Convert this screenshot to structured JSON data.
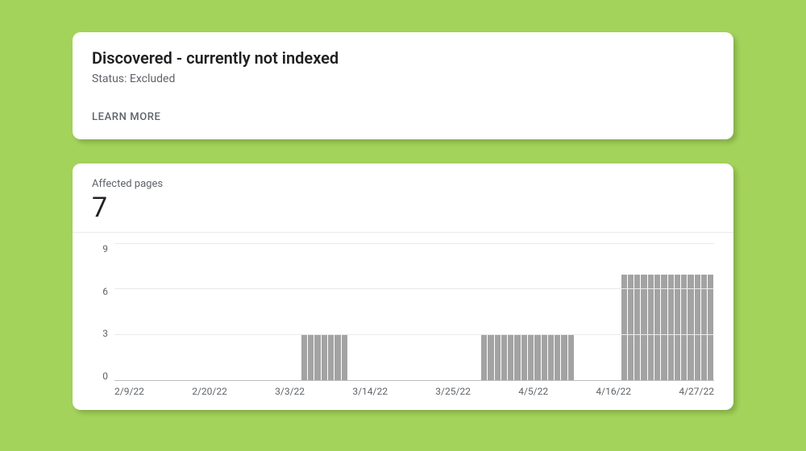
{
  "header": {
    "title": "Discovered - currently not indexed",
    "status_label": "Status:",
    "status_value": "Excluded",
    "learn_more": "LEARN MORE"
  },
  "metric": {
    "label": "Affected pages",
    "value": "7"
  },
  "chart_data": {
    "type": "bar",
    "title": "Affected pages",
    "xlabel": "",
    "ylabel": "",
    "ylim": [
      0,
      9
    ],
    "y_ticks": [
      9,
      6,
      3,
      0
    ],
    "x_tick_labels": [
      "2/9/22",
      "2/20/22",
      "3/3/22",
      "3/14/22",
      "3/25/22",
      "4/5/22",
      "4/16/22",
      "4/27/22"
    ],
    "values": [
      0,
      0,
      0,
      0,
      0,
      0,
      0,
      0,
      0,
      0,
      0,
      0,
      0,
      0,
      0,
      0,
      0,
      0,
      0,
      0,
      0,
      0,
      0,
      0,
      0,
      0,
      0,
      0,
      3,
      3,
      3,
      3,
      3,
      3,
      3,
      0,
      0,
      0,
      0,
      0,
      0,
      0,
      0,
      0,
      0,
      0,
      0,
      0,
      0,
      0,
      0,
      0,
      0,
      0,
      0,
      3,
      3,
      3,
      3,
      3,
      3,
      3,
      3,
      3,
      3,
      3,
      3,
      3,
      3,
      0,
      0,
      0,
      0,
      0,
      0,
      0,
      7,
      7,
      7,
      7,
      7,
      7,
      7,
      7,
      7,
      7,
      7,
      7,
      7,
      7
    ]
  }
}
